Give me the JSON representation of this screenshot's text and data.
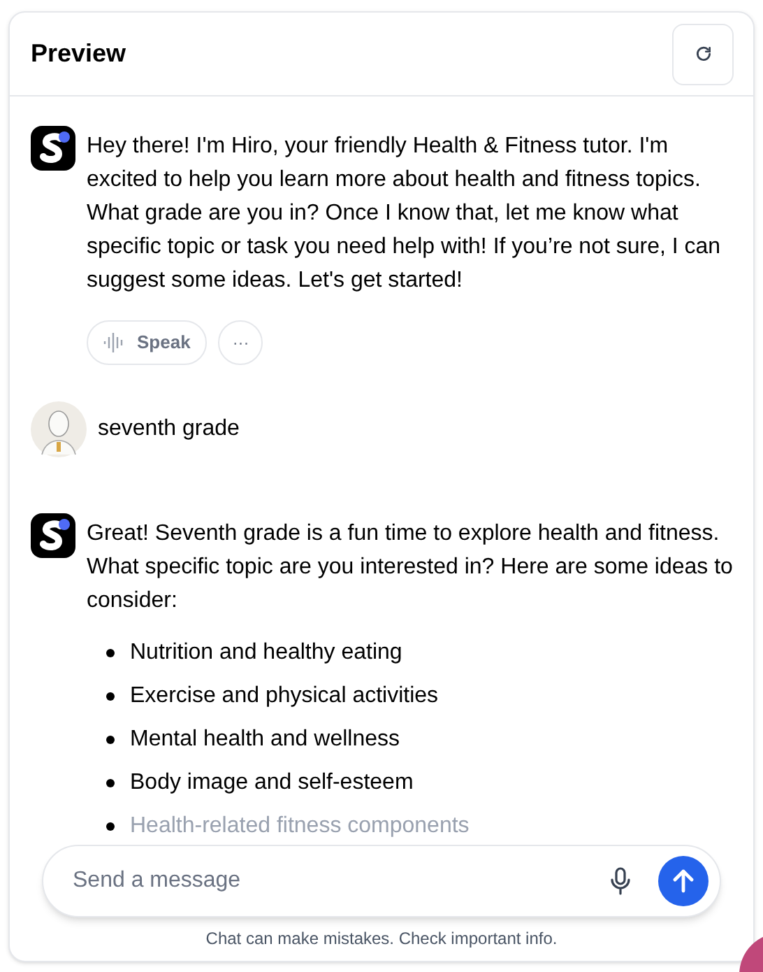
{
  "header": {
    "title": "Preview"
  },
  "messages": [
    {
      "kind": "bot",
      "text": "Hey there! I'm Hiro, your friendly Health & Fitness tutor. I'm excited to help you learn more about health and fitness topics. What grade are you in? Once I know that, let me know what specific topic or task you need help with! If you’re not sure, I can suggest some ideas. Let's get started!",
      "actions": {
        "speak": "Speak",
        "more": "···"
      }
    },
    {
      "kind": "user",
      "text": "seventh grade"
    },
    {
      "kind": "bot",
      "text": "Great! Seventh grade is a fun time to explore health and fitness. What specific topic are you interested in? Here are some ideas to consider:",
      "list": [
        "Nutrition and healthy eating",
        "Exercise and physical activities",
        "Mental health and wellness",
        "Body image and self-esteem",
        "Health-related fitness components"
      ]
    }
  ],
  "composer": {
    "placeholder": "Send a message"
  },
  "disclaimer": "Chat can make mistakes. Check important info."
}
